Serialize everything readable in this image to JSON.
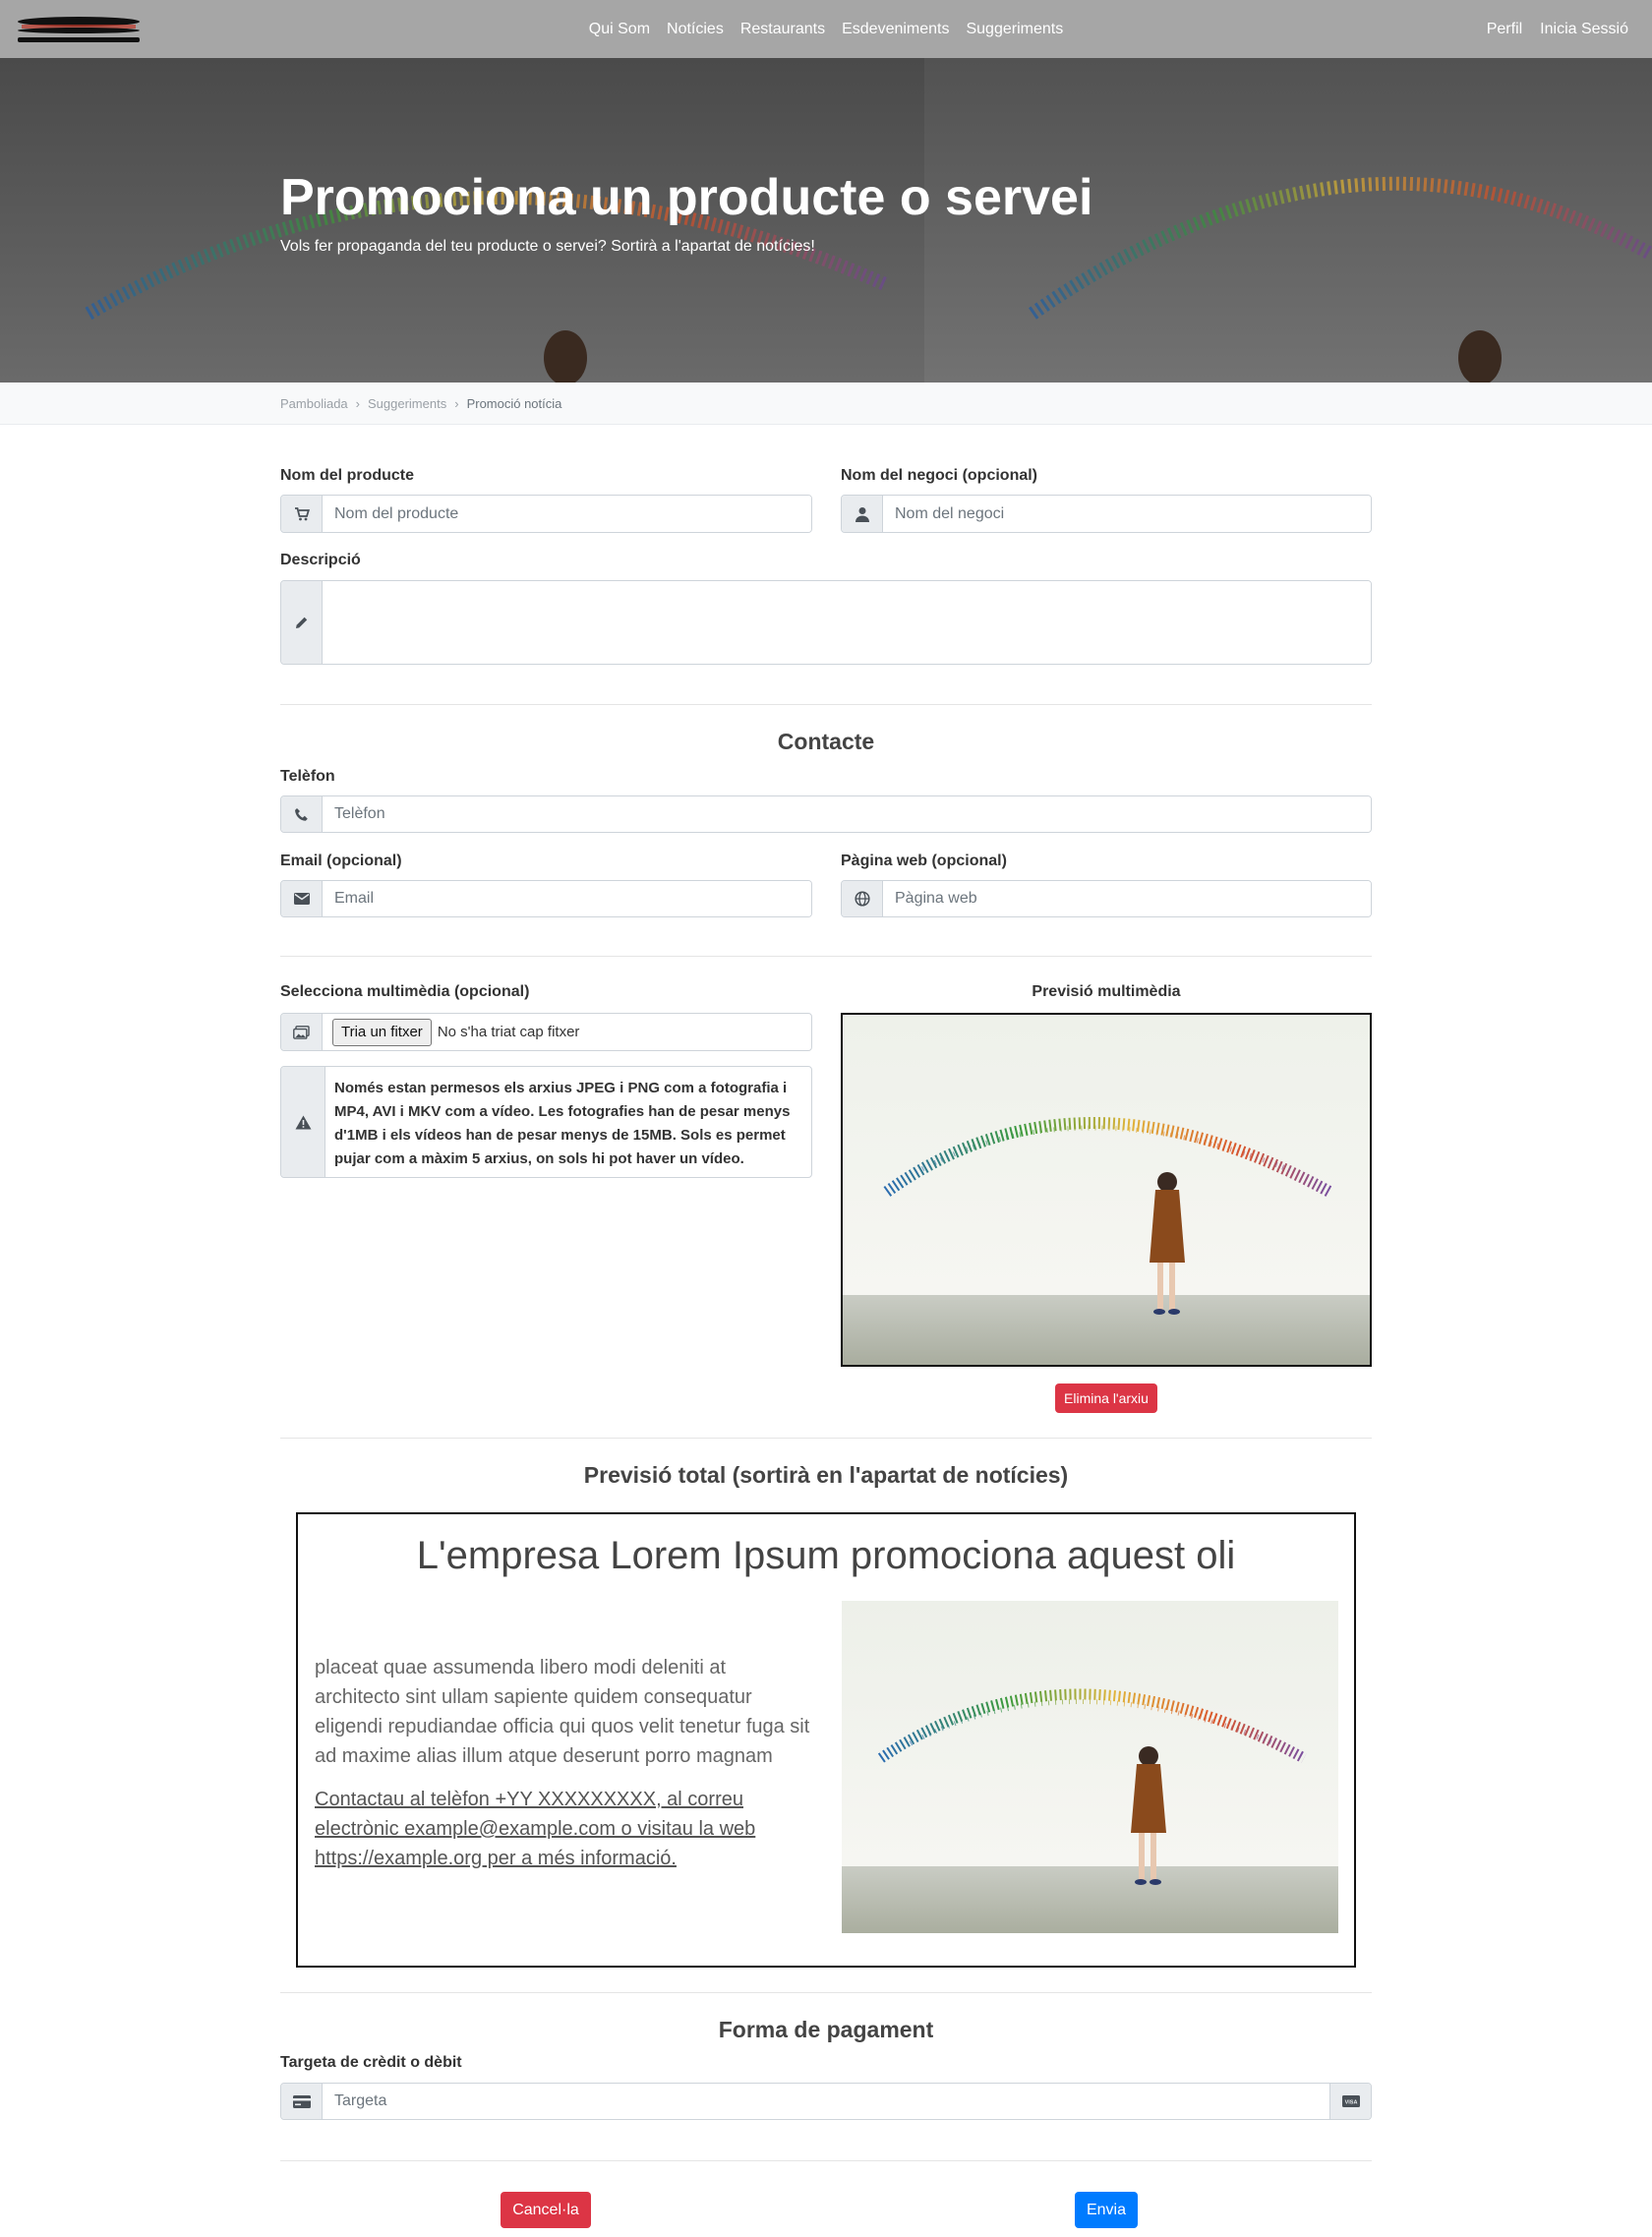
{
  "nav": {
    "links": [
      "Qui Som",
      "Notícies",
      "Restaurants",
      "Esdeveniments",
      "Suggeriments"
    ],
    "profile": "Perfil",
    "login": "Inicia Sessió"
  },
  "hero": {
    "title": "Promociona un producte o servei",
    "subtitle": "Vols fer propaganda del teu producte o servei? Sortirà a l'apartat de notícies!"
  },
  "breadcrumb": [
    "Pamboliada",
    "Suggeriments",
    "Promoció notícia"
  ],
  "form": {
    "product_label": "Nom del producte",
    "product_placeholder": "Nom del producte",
    "business_label": "Nom del negoci (opcional)",
    "business_placeholder": "Nom del negoci",
    "description_label": "Descripció",
    "contact_title": "Contacte",
    "phone_label": "Telèfon",
    "phone_placeholder": "Telèfon",
    "email_label": "Email (opcional)",
    "email_placeholder": "Email",
    "web_label": "Pàgina web (opcional)",
    "web_placeholder": "Pàgina web",
    "media_label": "Selecciona multimèdia (opcional)",
    "file_button": "Tria un fitxer",
    "file_status": "No s'ha triat cap fitxer",
    "media_notice": "Només estan permesos els arxius JPEG i PNG com a fotografia i MP4, AVI i MKV com a vídeo. Les fotografies han de pesar menys d'1MB i els vídeos han de pesar menys de 15MB. Sols es permet pujar com a màxim 5 arxius, on sols hi pot haver un vídeo.",
    "media_preview_title": "Previsió multimèdia",
    "delete_file": "Elimina l'arxiu"
  },
  "preview": {
    "section_title": "Previsió total (sortirà en l'apartat de notícies)",
    "heading": "L'empresa Lorem Ipsum promociona aquest oli",
    "body": "placeat quae assumenda libero modi deleniti at architecto sint ullam sapiente quidem consequatur eligendi repudiandae officia qui quos velit tenetur fuga sit ad maxime alias illum atque deserunt porro magnam",
    "contact": "Contactau al telèfon +YY XXXXXXXXX, al correu electrònic example@example.com o visitau la web https://example.org per a més informació."
  },
  "payment": {
    "title": "Forma de pagament",
    "card_label": "Targeta de crèdit o dèbit",
    "card_placeholder": "Targeta",
    "card_brand": "VISA"
  },
  "actions": {
    "cancel": "Cancel·la",
    "send": "Envia"
  },
  "colors": {
    "navbar": "#a6a6a6",
    "danger": "#dc3545",
    "primary": "#007bff"
  }
}
